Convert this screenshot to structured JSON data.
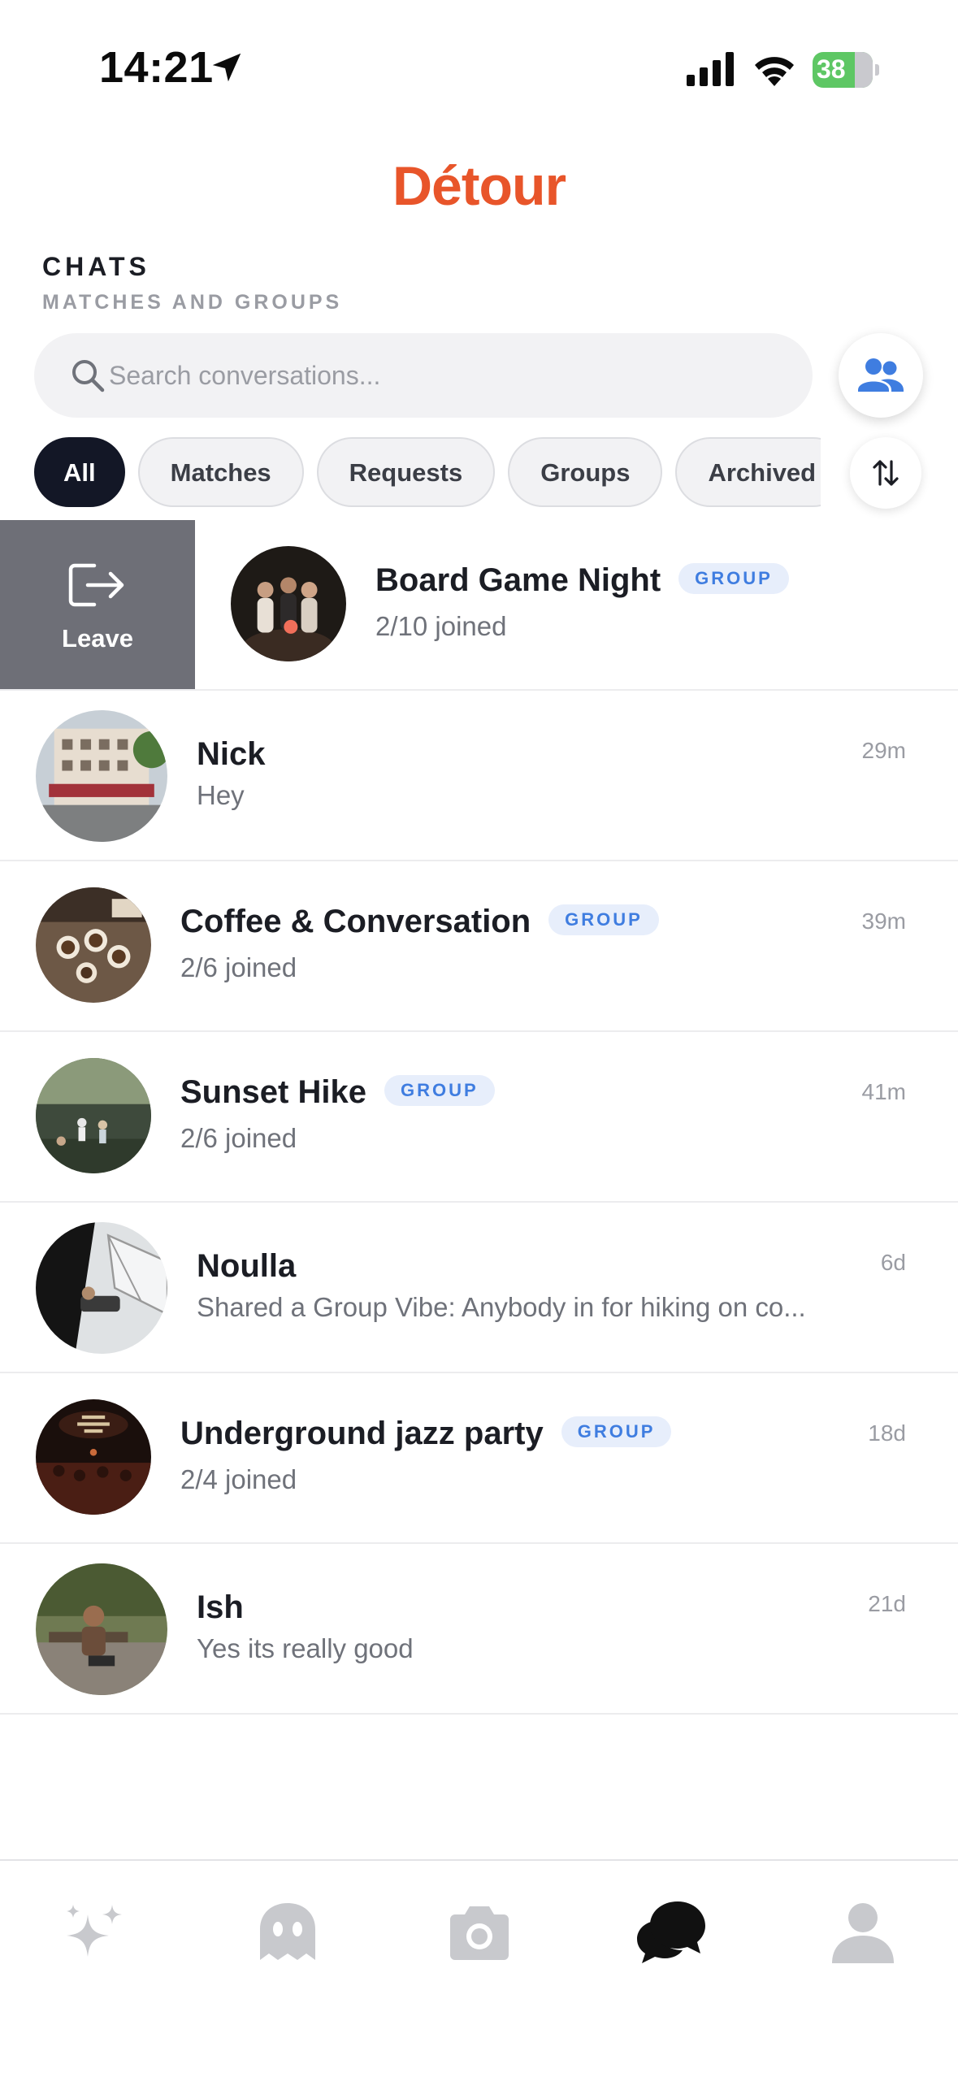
{
  "status_bar": {
    "time": "14:21",
    "battery": "38"
  },
  "header": {
    "app_name": "Détour",
    "section_title": "CHATS",
    "section_subtitle": "MATCHES AND GROUPS"
  },
  "search": {
    "placeholder": "Search conversations..."
  },
  "filters": [
    "All",
    "Matches",
    "Requests",
    "Groups",
    "Archived"
  ],
  "active_filter": "All",
  "swipe_action": {
    "label": "Leave"
  },
  "group_badge_label": "GROUP",
  "chats": [
    {
      "name": "Board Game Night",
      "group": true,
      "preview": "2/10 joined",
      "time": ""
    },
    {
      "name": "Nick",
      "group": false,
      "preview": "Hey",
      "time": "29m"
    },
    {
      "name": "Coffee & Conversation",
      "group": true,
      "preview": "2/6 joined",
      "time": "39m"
    },
    {
      "name": "Sunset Hike",
      "group": true,
      "preview": "2/6 joined",
      "time": "41m"
    },
    {
      "name": "Noulla",
      "group": false,
      "preview": "Shared a Group Vibe: Anybody in for hiking on co...",
      "time": "6d"
    },
    {
      "name": "Underground jazz party",
      "group": true,
      "preview": "2/4 joined",
      "time": "18d"
    },
    {
      "name": "Ish",
      "group": false,
      "preview": "Yes its really good",
      "time": "21d"
    }
  ],
  "bottom_nav": [
    {
      "icon": "sparkles-icon",
      "active": false
    },
    {
      "icon": "ghost-icon",
      "active": false
    },
    {
      "icon": "camera-icon",
      "active": false
    },
    {
      "icon": "chat-bubbles-icon",
      "active": true
    },
    {
      "icon": "profile-icon",
      "active": false
    }
  ],
  "colors": {
    "brand": "#e8552a",
    "badge": "#3f7de0",
    "active_chip": "#131726",
    "leave": "#6e6f77"
  }
}
